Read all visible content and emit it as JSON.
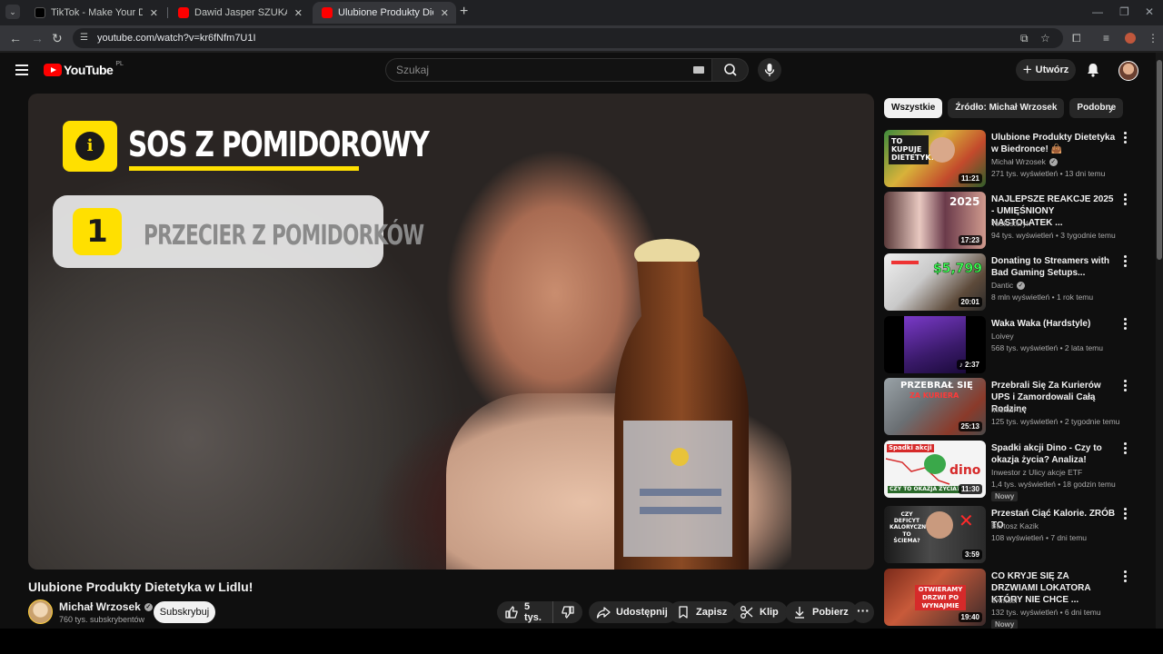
{
  "browser": {
    "tabs": [
      {
        "title": "TikTok - Make Your Day",
        "active": false
      },
      {
        "title": "Dawid Jasper SZUKANIE MIŁOŚ",
        "active": false
      },
      {
        "title": "Ulubione Produkty Dietetyka w",
        "active": true
      }
    ],
    "url": "youtube.com/watch?v=kr6fNfm7U1I"
  },
  "header": {
    "logo_text": "YouTube",
    "country_code": "PL",
    "search_placeholder": "Szukaj",
    "create_label": "Utwórz"
  },
  "video": {
    "overlay_title": "SOS Z POMIDOROWY",
    "step_number": "1",
    "step_text": "PRZECIER Z POMIDORKÓW",
    "title": "Ulubione Produkty Dietetyka w Lidlu!",
    "channel": "Michał Wrzosek",
    "subscribers": "760 tys. subskrybentów",
    "subscribe_label": "Subskrybuj",
    "likes": "5 tys.",
    "share_label": "Udostępnij",
    "save_label": "Zapisz",
    "clip_label": "Klip",
    "download_label": "Pobierz"
  },
  "sidebar": {
    "chips": [
      "Wszystkie",
      "Źródło: Michał Wrzosek",
      "Podobne"
    ],
    "recommendations": [
      {
        "title": "Ulubione Produkty Dietetyka w Biedronce! 👜",
        "channel": "Michał Wrzosek",
        "verified": true,
        "meta": "271 tys. wyświetleń • 13 dni temu",
        "duration": "11:21",
        "badge": "",
        "thumb_text": "TO KUPUJE DIETETYK!"
      },
      {
        "title": "NAJLEPSZE REAKCJE 2025 - UMIĘŚNIONY NASTOLATEK ...",
        "channel": "Testosteryk",
        "verified": false,
        "meta": "94 tys. wyświetleń • 3 tygodnie temu",
        "duration": "17:23",
        "badge": "",
        "thumb_text": "2025"
      },
      {
        "title": "Donating to Streamers with Bad Gaming Setups...",
        "channel": "Dantic",
        "verified": true,
        "meta": "8 mln wyświetleń • 1 rok temu",
        "duration": "20:01",
        "badge": "",
        "thumb_text": "$5,799"
      },
      {
        "title": "Waka Waka (Hardstyle)",
        "channel": "Loivey",
        "verified": false,
        "meta": "568 tys. wyświetleń • 2 lata temu",
        "duration": "2:37",
        "badge": "",
        "thumb_text": ""
      },
      {
        "title": "Przebrali Się Za Kurierów UPS i Zamordowali Całą Rodzinę",
        "channel": "MichałF1",
        "verified": false,
        "meta": "125 tys. wyświetleń • 2 tygodnie temu",
        "duration": "25:13",
        "badge": "",
        "thumb_text": "PRZEBRAŁ SIĘ"
      },
      {
        "title": "Spadki akcji Dino - Czy to okazja życia? Analiza!",
        "channel": "Inwestor z Ulicy akcje ETF",
        "verified": false,
        "meta": "1,4 tys. wyświetleń • 18 godzin temu",
        "duration": "11:30",
        "badge": "Nowy",
        "thumb_text": "dino"
      },
      {
        "title": "Przestań Ciąć Kalorie. ZRÓB TO",
        "channel": "Bartosz Kazik",
        "verified": false,
        "meta": "108 wyświetleń • 7 dni temu",
        "duration": "3:59",
        "badge": "",
        "thumb_text": "CZY DEFICYT KALORYCZNY TO ŚCIEMA?"
      },
      {
        "title": "CO KRYJE SIĘ ZA DRZWIAMI LOKATORA KTÓRY NIE CHCE ...",
        "channel": "eXmiter",
        "verified": false,
        "meta": "132 tys. wyświetleń • 6 dni temu",
        "duration": "19:40",
        "badge": "Nowy",
        "thumb_text": "OTWIERAMY DRZWI PO WYNAJMIE"
      }
    ]
  },
  "colors": {
    "youtube_red": "#ff0000",
    "overlay_yellow": "#ffe000",
    "background": "#0f0f0f"
  }
}
